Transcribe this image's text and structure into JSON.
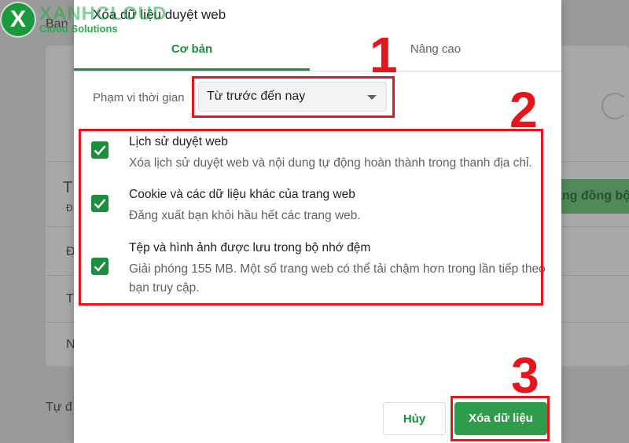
{
  "logo": {
    "letter": "X",
    "name": "XANHCLOUD",
    "tagline": "Cloud Solutions"
  },
  "background": {
    "fragments": [
      "Bạn",
      "T",
      "Đ",
      "Đ",
      "T",
      "N",
      "Tự đ"
    ],
    "sync_button": "ăng đồng bộ"
  },
  "dialog": {
    "title": "Xóa dữ liệu duyệt web",
    "tabs": [
      {
        "label": "Cơ bản",
        "active": true
      },
      {
        "label": "Nâng cao",
        "active": false
      }
    ],
    "time_range": {
      "label": "Phạm vi thời gian",
      "selected": "Từ trước đến nay"
    },
    "options": [
      {
        "title": "Lịch sử duyệt web",
        "description": "Xóa lịch sử duyệt web và nội dung tự động hoàn thành trong thanh địa chỉ.",
        "checked": true
      },
      {
        "title": "Cookie và các dữ liệu khác của trang web",
        "description": "Đăng xuất bạn khỏi hầu hết các trang web.",
        "checked": true
      },
      {
        "title": "Tệp và hình ảnh được lưu trong bộ nhớ đệm",
        "description": "Giải phóng 155 MB. Một số trang web có thể tải chậm hơn trong lần tiếp theo bạn truy cập.",
        "checked": true
      }
    ],
    "cancel_label": "Hủy",
    "clear_label": "Xóa dữ liệu"
  },
  "annotations": {
    "step1": "1",
    "step2": "2",
    "step3": "3"
  },
  "colors": {
    "accent": "#1e8e3e",
    "annotation": "#e8141b"
  }
}
